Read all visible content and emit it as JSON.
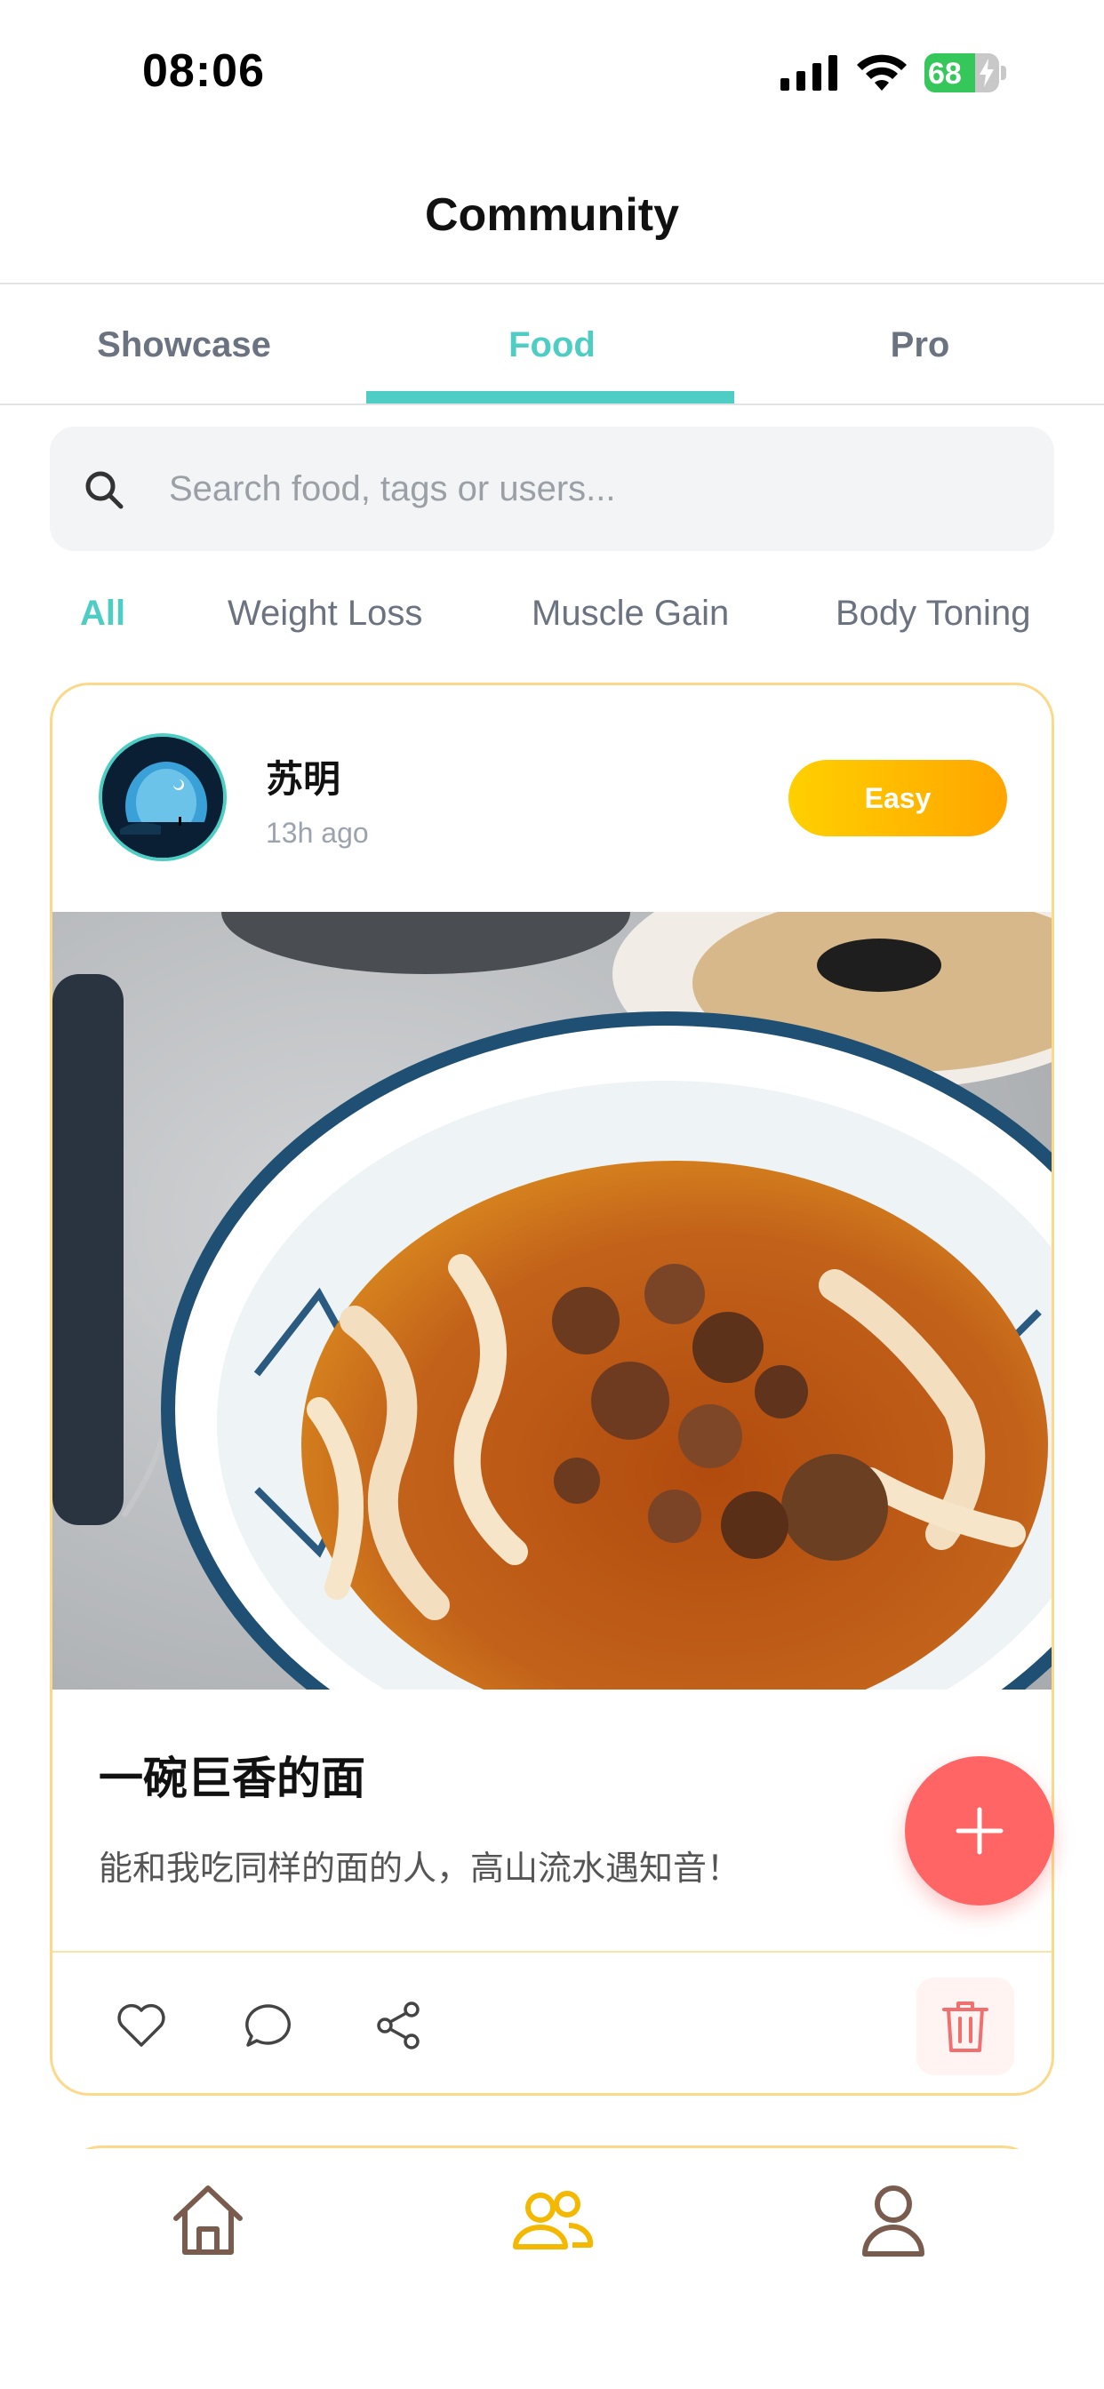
{
  "status_bar": {
    "time": "08:06",
    "battery": "68",
    "battery_level": 0.68
  },
  "header": {
    "title": "Community"
  },
  "tabs": [
    {
      "label": "Showcase",
      "active": false
    },
    {
      "label": "Food",
      "active": true
    },
    {
      "label": "Pro",
      "active": false
    }
  ],
  "search": {
    "placeholder": "Search food, tags or users...",
    "value": ""
  },
  "filters": [
    {
      "label": "All",
      "active": true
    },
    {
      "label": "Weight Loss",
      "active": false
    },
    {
      "label": "Muscle Gain",
      "active": false
    },
    {
      "label": "Body Toning",
      "active": false
    }
  ],
  "post": {
    "username": "苏明",
    "time_ago": "13h ago",
    "difficulty": "Easy",
    "title": "一碗巨香的面",
    "description": "能和我吃同样的面的人，高山流水遇知音！",
    "actions": [
      "heart-icon",
      "comment-icon",
      "share-icon",
      "trash-icon"
    ]
  },
  "fab": {
    "icon": "plus-icon"
  },
  "bottom_nav": [
    {
      "icon": "home-icon",
      "active": false
    },
    {
      "icon": "community-icon",
      "active": true
    },
    {
      "icon": "profile-icon",
      "active": false
    }
  ],
  "colors": {
    "accent": "#4ecdc4",
    "card_border": "#fcd98a",
    "badge_start": "#ffd000",
    "badge_end": "#ffa500",
    "fab": "#ff6565",
    "nav_active": "#f5b800",
    "nav_inactive": "#7a5c4f"
  }
}
